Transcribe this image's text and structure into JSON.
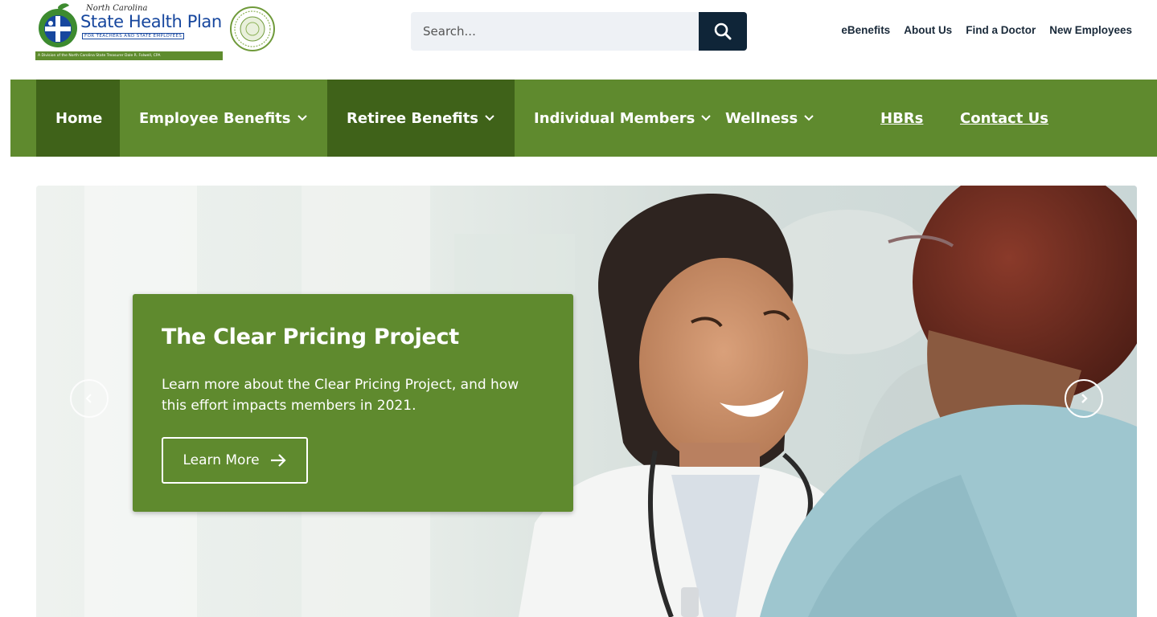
{
  "header": {
    "logo": {
      "line1": "North Carolina",
      "line2": "State Health Plan",
      "line3": "FOR TEACHERS AND STATE EMPLOYEES",
      "strip": "A Division of the North Carolina State Treasurer Dale R. Folwell, CPA"
    },
    "search": {
      "placeholder": "Search..."
    },
    "utility_links": [
      "eBenefits",
      "About Us",
      "Find a Doctor",
      "New Employees"
    ]
  },
  "nav": {
    "items": [
      {
        "label": "Home"
      },
      {
        "label": "Employee Benefits"
      },
      {
        "label": "Retiree Benefits"
      },
      {
        "label": "Individual Members"
      },
      {
        "label": "Wellness"
      },
      {
        "label": "HBRs"
      },
      {
        "label": "Contact Us"
      }
    ]
  },
  "hero": {
    "title": "The Clear Pricing Project",
    "text": "Learn more about the Clear Pricing Project, and how this effort impacts members in 2021.",
    "button_label": "Learn More"
  },
  "colors": {
    "nav_green": "#5f8a2e",
    "nav_dark_green": "#3f6219",
    "search_button": "#0f2538",
    "brand_blue": "#17479e"
  },
  "icons": {
    "search": "search-icon",
    "chevron": "chevron-down-icon",
    "arrow": "arrow-right-icon",
    "prev": "chevron-left-icon",
    "next": "chevron-right-icon"
  }
}
